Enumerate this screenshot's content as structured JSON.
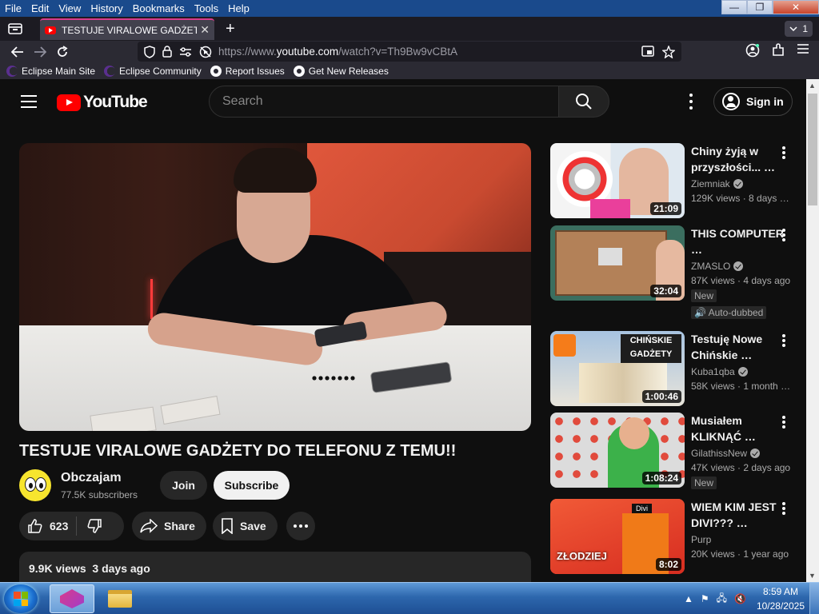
{
  "menubar": {
    "items": [
      "File",
      "Edit",
      "View",
      "History",
      "Bookmarks",
      "Tools",
      "Help"
    ]
  },
  "window_controls": {
    "minimize": "—",
    "maximize": "❐",
    "close": "✕"
  },
  "tabs": {
    "active_title": "TESTUJE VIRALOWE GADŻETY D",
    "close_glyph": "✕",
    "new_tab_glyph": "+",
    "all_tabs_count": "1"
  },
  "navbar": {
    "url_prefix": "https://www.",
    "url_domain": "youtube.com",
    "url_rest": "/watch?v=Th9Bw9vCBtA"
  },
  "bookmarks": [
    {
      "label": "Eclipse Main Site",
      "icon": "eclipse-icon"
    },
    {
      "label": "Eclipse Community",
      "icon": "eclipse-icon"
    },
    {
      "label": "Report Issues",
      "icon": "github-icon"
    },
    {
      "label": "Get New Releases",
      "icon": "github-icon"
    }
  ],
  "youtube": {
    "logo_text": "YouTube",
    "search_placeholder": "Search",
    "signin_label": "Sign in",
    "video": {
      "title": "TESTUJE VIRALOWE GADŻETY DO TELEFONU Z TEMU!!",
      "channel": "Obczajam",
      "subscribers": "77.5K subscribers",
      "join_label": "Join",
      "subscribe_label": "Subscribe",
      "likes": "623",
      "share_label": "Share",
      "save_label": "Save",
      "views": "9.9K views",
      "age": "3 days ago"
    },
    "related": [
      {
        "title": "Chiny żyją w przyszłości... …",
        "channel": "Ziemniak",
        "verified": true,
        "views": "129K views",
        "age": "8 days …",
        "duration": "21:09",
        "badges": []
      },
      {
        "title": "THIS COMPUTER …",
        "channel": "ZMASLO",
        "verified": true,
        "views": "87K views",
        "age": "4 days ago",
        "duration": "32:04",
        "badges": [
          "New",
          "Auto-dubbed"
        ]
      },
      {
        "title": "Testuję Nowe Chińskie …",
        "channel": "Kuba1qba",
        "verified": true,
        "views": "58K views",
        "age": "1 month …",
        "duration": "1:00:46",
        "badges": [],
        "thumb_text": "CHIŃSKIE GADŻETY"
      },
      {
        "title": "Musiałem KLIKNĄĆ …",
        "channel": "GilathissNew",
        "verified": true,
        "views": "47K views",
        "age": "2 days ago",
        "duration": "1:08:24",
        "badges": [
          "New"
        ]
      },
      {
        "title": "WIEM KIM JEST DIVI??? …",
        "channel": "Purp",
        "verified": false,
        "views": "20K views",
        "age": "1 year ago",
        "duration": "8:02",
        "badges": [],
        "thumb_tag": "Divi",
        "thumb_text": "ZŁODZIEJ"
      }
    ]
  },
  "taskbar": {
    "time": "8:59 AM",
    "date": "10/28/2025"
  },
  "colors": {
    "yt_background": "#0f0f0f",
    "yt_red": "#ff0000",
    "firefox_tab_accent": "#d93b8c"
  }
}
